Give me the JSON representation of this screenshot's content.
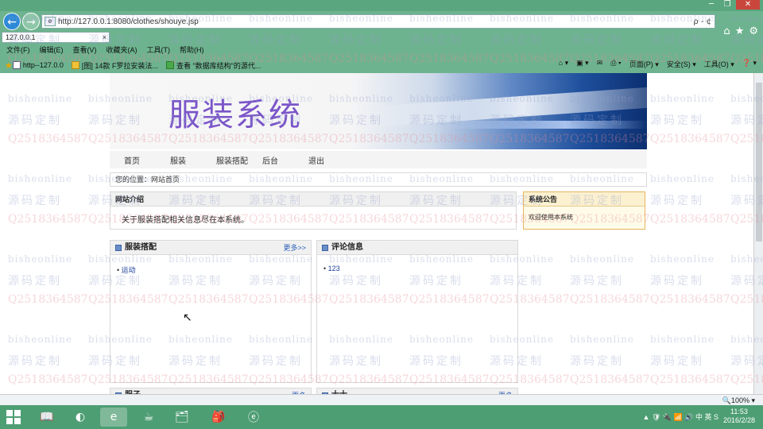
{
  "browser": {
    "window_controls": [
      "─",
      "❐",
      "✕"
    ],
    "address_url": "http://127.0.0.1:8080/clothes/shouye.jsp",
    "address_tools": "ρ - ¢",
    "tab_label": "127.0.0.1",
    "tab_close": "×",
    "right_icons": [
      "⌂",
      "★",
      "⚙"
    ],
    "menu": [
      "文件(F)",
      "编辑(E)",
      "查看(V)",
      "收藏夹(A)",
      "工具(T)",
      "帮助(H)"
    ],
    "favorites": [
      {
        "label": "http--127.0.0",
        "icon": "page-icon"
      },
      {
        "label": "[图] 14款 F罗拉安装法...",
        "icon": "yellow-icon"
      },
      {
        "label": "查看 \"数据库结构\"的源代...",
        "icon": "green-icon"
      }
    ],
    "command_bar": [
      "⌂ ▾",
      "▣ ▾",
      "✉",
      "⎙ ▾",
      "页面(P) ▾",
      "安全(S) ▾",
      "工具(O) ▾",
      "❓ ▾"
    ],
    "zoom": "🔍100% ▾"
  },
  "site": {
    "title": "服装系统",
    "nav": [
      "首页",
      "服装",
      "服装搭配",
      "后台",
      "退出"
    ],
    "location": "您的位置：网站首页",
    "intro": {
      "heading": "网站介绍",
      "text": "关于服装搭配相关信息尽在本系统。"
    },
    "notice": {
      "heading": "系统公告",
      "text": "欢迎使用本系统"
    },
    "boxes": [
      {
        "heading": "服装搭配",
        "more": "更多>>",
        "items": [
          "运动"
        ]
      },
      {
        "heading": "评论信息",
        "more": "",
        "items": [
          "123"
        ]
      },
      {
        "heading": "服子",
        "more": "更多",
        "items": []
      },
      {
        "heading": "士士",
        "more": "更多",
        "items": []
      }
    ]
  },
  "watermarks": {
    "latin": "bisheonline",
    "chinese": "源码定制",
    "qq": "Q2518364587"
  },
  "taskbar": {
    "icons": [
      "📖",
      "◐",
      "e",
      "☕",
      "🗂",
      "🎒",
      "ⓔ"
    ],
    "tray": "▲ 🛡 🔌 📶 🔊 中 英 S",
    "time": "11:53",
    "date": "2016/2/28"
  }
}
